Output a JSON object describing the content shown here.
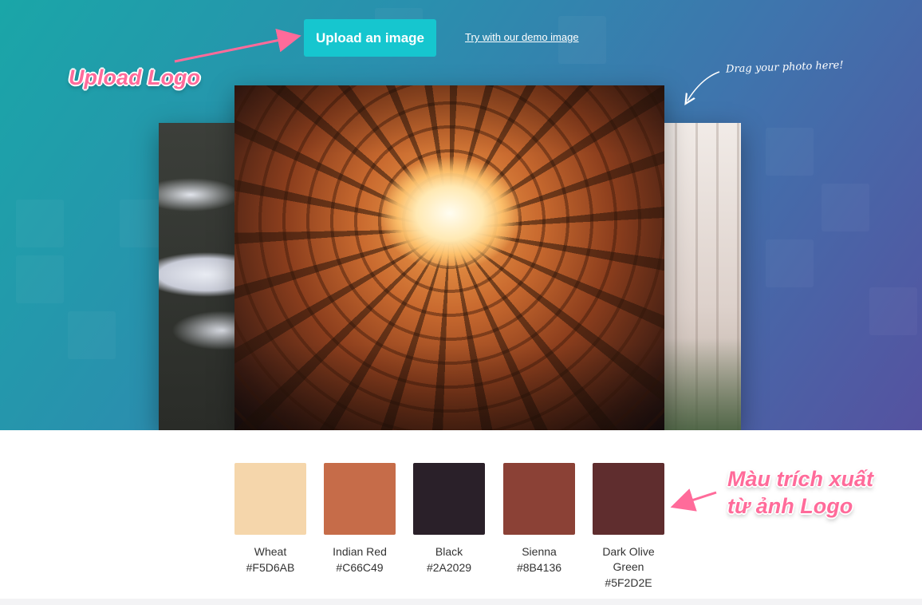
{
  "hero": {
    "upload_button": "Upload an image",
    "demo_link": "Try with our demo image",
    "drag_hint": "Drag your photo here!"
  },
  "annotations": {
    "upload": "Upload Logo",
    "colors_line1": "Màu trích xuất",
    "colors_line2": "từ ảnh Logo",
    "color": "#ff6b9a"
  },
  "palette": [
    {
      "name": "Wheat",
      "hex": "#F5D6AB"
    },
    {
      "name": "Indian Red",
      "hex": "#C66C49"
    },
    {
      "name": "Black",
      "hex": "#2A2029"
    },
    {
      "name": "Sienna",
      "hex": "#8B4136"
    },
    {
      "name": "Dark Olive Green",
      "hex": "#5F2D2E"
    }
  ]
}
